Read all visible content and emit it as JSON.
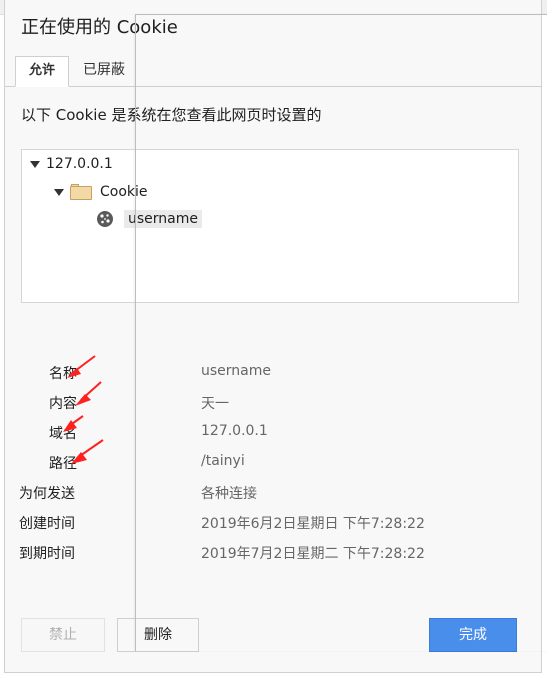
{
  "dialog": {
    "title": "正在使用的 Cookie",
    "tabs": [
      {
        "label": "允许",
        "active": true
      },
      {
        "label": "已屏蔽",
        "active": false
      }
    ],
    "description": "以下 Cookie 是系统在您查看此网页时设置的"
  },
  "tree": {
    "site": "127.0.0.1",
    "folder": "Cookie",
    "cookie": "username",
    "icons": {
      "site_toggle": "triangle-down-icon",
      "folder_toggle": "triangle-down-icon",
      "folder": "folder-icon",
      "cookie": "cookie-icon"
    }
  },
  "details": [
    {
      "label": "名称",
      "value": "username"
    },
    {
      "label": "内容",
      "value": "天一"
    },
    {
      "label": "域名",
      "value": "127.0.0.1"
    },
    {
      "label": "路径",
      "value": "/tainyi"
    },
    {
      "label": "为何发送",
      "value": "各种连接"
    },
    {
      "label": "创建时间",
      "value": "2019年6月2日星期日 下午7:28:22"
    },
    {
      "label": "到期时间",
      "value": "2019年7月2日星期二 下午7:28:22"
    }
  ],
  "buttons": {
    "block": "禁止",
    "delete": "删除",
    "done": "完成"
  },
  "colors": {
    "primary": "#4a8eeb",
    "annotation_arrow": "#ff2020"
  }
}
